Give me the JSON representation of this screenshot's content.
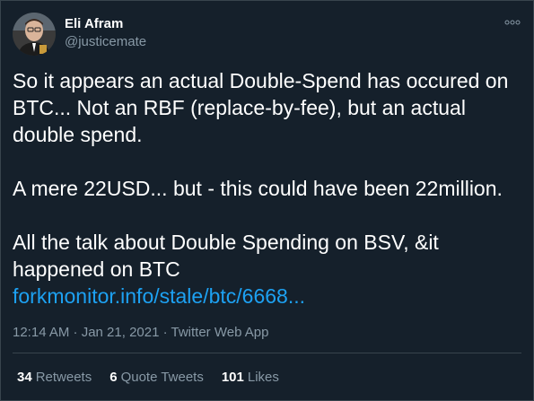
{
  "author": {
    "display_name": "Eli Afram",
    "handle": "@justicemate"
  },
  "tweet": {
    "text": "So it appears an actual Double-Spend has occured on BTC... Not an RBF (replace-by-fee), but an actual double spend.\n\nA mere 22USD... but - this could have been 22million.\n\nAll the talk about Double Spending on BSV, &it happened on BTC",
    "link_text": "forkmonitor.info/stale/btc/6668..."
  },
  "meta": {
    "timestamp": "12:14 AM · Jan 21, 2021 · Twitter Web App"
  },
  "stats": {
    "retweets_count": "34",
    "retweets_label": "Retweets",
    "quote_tweets_count": "6",
    "quote_tweets_label": "Quote Tweets",
    "likes_count": "101",
    "likes_label": "Likes"
  },
  "colors": {
    "background": "#15202b",
    "link": "#1da1f2",
    "secondary_text": "#8899a6",
    "border": "#38444d"
  },
  "icons": {
    "more": "more-options-icon",
    "avatar": "avatar"
  }
}
